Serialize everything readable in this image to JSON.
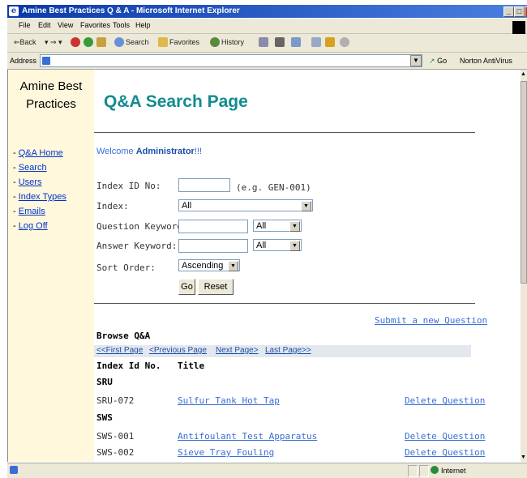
{
  "window": {
    "title": "Amine Best Practices Q & A - Microsoft Internet Explorer",
    "minimize": "_",
    "restore": "□",
    "close": "×"
  },
  "menubar": {
    "items": [
      "File",
      "Edit",
      "View",
      "Favorites",
      "Tools",
      "Help"
    ]
  },
  "toolbar": {
    "back": "⇐Back",
    "search": "Search",
    "favorites": "Favorites",
    "history": "History"
  },
  "address_bar": {
    "label": "Address",
    "value": "",
    "go": "Go",
    "norton": "Norton AntiVirus"
  },
  "sidebar": {
    "logo": "Amine Best Practices",
    "nav": [
      "Q&A Home",
      "Search",
      "Users",
      "Index Types",
      "Emails",
      "Log Off"
    ]
  },
  "page": {
    "title": "Q&A Search Page",
    "welcome_prefix": "Welcome ",
    "welcome_user": "Administrator",
    "welcome_suffix": "!!!"
  },
  "form": {
    "index_id_label": "Index ID No:",
    "index_id_value": "",
    "index_id_hint": "(e.g. GEN-001)",
    "index_label": "Index:",
    "index_value": "All",
    "question_keyword_label": "Question Keyword:",
    "question_keyword_value": "",
    "question_scope": "All",
    "answer_keyword_label": "Answer Keyword:",
    "answer_keyword_value": "",
    "answer_scope": "All",
    "sort_order_label": "Sort Order:",
    "sort_order_value": "Ascending",
    "go_label": "Go",
    "reset_label": "Reset"
  },
  "results": {
    "submit_link": "Submit a new Question",
    "browse_title": "Browse Q&A",
    "pager": [
      "<<First Page",
      "<Previous Page",
      "Next Page>",
      "Last Page>>"
    ],
    "col_index": "Index Id No.",
    "col_title": "Title",
    "groups": [
      {
        "name": "SRU",
        "rows": [
          {
            "id": "SRU-072",
            "title": "Sulfur Tank Hot Tap",
            "action": "Delete Question"
          }
        ]
      },
      {
        "name": "SWS",
        "rows": [
          {
            "id": "SWS-001",
            "title": "Antifoulant Test Apparatus",
            "action": "Delete Question"
          },
          {
            "id": "SWS-002",
            "title": "Sieve Tray Fouling",
            "action": "Delete Question"
          }
        ]
      }
    ]
  },
  "status_bar": {
    "zone": "Internet"
  },
  "colors": {
    "title_teal": "#138b8f",
    "link_blue": "#3a6ed6",
    "sidebar_bg": "#fff8dc",
    "titlebar_blue": "#1d4fb8"
  }
}
